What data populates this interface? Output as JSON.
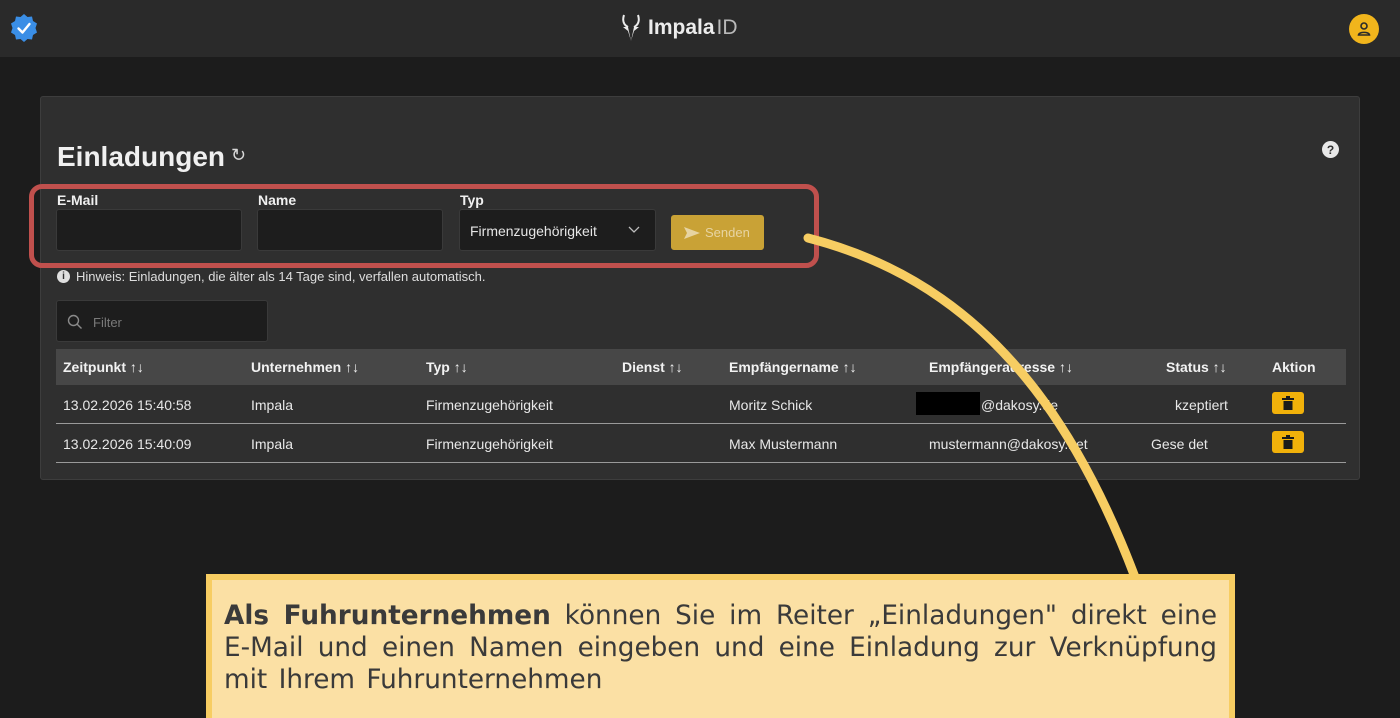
{
  "header": {
    "brand": "Impala",
    "brand_suffix": "ID"
  },
  "page": {
    "title": "Einladungen",
    "refresh_icon": "refresh-icon",
    "help_icon": "?"
  },
  "form": {
    "email_label": "E-Mail",
    "email_value": "",
    "name_label": "Name",
    "name_value": "",
    "type_label": "Typ",
    "type_value": "Firmenzugehörigkeit",
    "send_label": "Senden"
  },
  "hint": "Hinweis: Einladungen, die älter als 14 Tage sind, verfallen automatisch.",
  "filter": {
    "placeholder": "Filter"
  },
  "table": {
    "columns": [
      "Zeitpunkt ↑↓",
      "Unternehmen ↑↓",
      "Typ ↑↓",
      "Dienst ↑↓",
      "Empfängername ↑↓",
      "Empfängeradresse ↑↓",
      "Status ↑↓",
      "Aktion"
    ],
    "rows": [
      {
        "zeitpunkt": "13.02.2026 15:40:58",
        "unternehmen": "Impala",
        "typ": "Firmenzugehörigkeit",
        "dienst": "",
        "name": "Moritz Schick",
        "adresse": "@dakosy.de",
        "status": "kzeptiert"
      },
      {
        "zeitpunkt": "13.02.2026 15:40:09",
        "unternehmen": "Impala",
        "typ": "Firmenzugehörigkeit",
        "dienst": "",
        "name": "Max Mustermann",
        "adresse": "mustermann@dakosy.net",
        "status": "Gese det"
      }
    ]
  },
  "callout": {
    "bold": "Als Fuhrunternehmen",
    "text": " können Sie im Reiter „Einladungen\" direkt eine E-Mail und einen Namen eingeben und eine Einladung zur Verknüpfung mit Ihrem Fuhrunternehmen"
  },
  "colors": {
    "accent": "#f1b10a",
    "highlight_border": "#c0504d",
    "callout_bg": "#fbe0a4",
    "callout_border": "#f7cd62"
  }
}
